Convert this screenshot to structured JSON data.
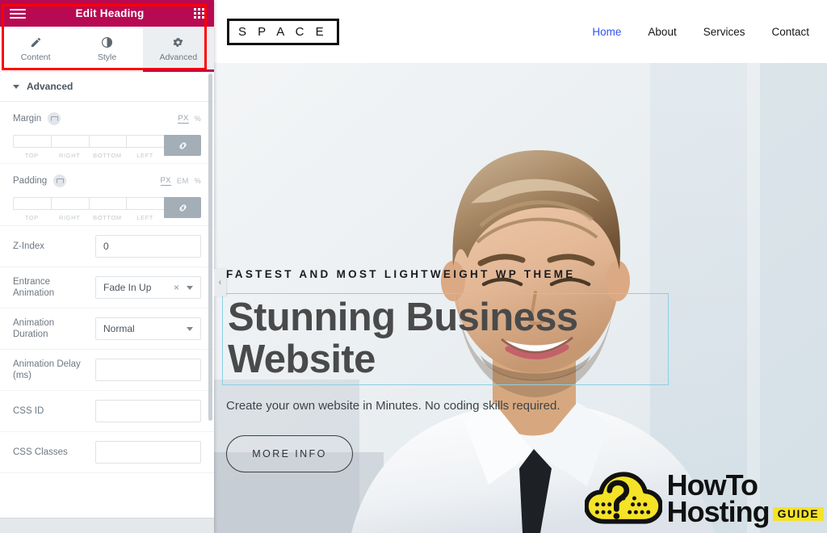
{
  "panel": {
    "header": {
      "title": "Edit Heading",
      "menu_icon": "hamburger-icon",
      "widgets_icon": "grid-icon"
    },
    "tabs": [
      {
        "label": "Content",
        "icon": "pencil-icon",
        "active": false
      },
      {
        "label": "Style",
        "icon": "contrast-icon",
        "active": false
      },
      {
        "label": "Advanced",
        "icon": "gear-icon",
        "active": true
      }
    ],
    "section": {
      "title": "Advanced"
    },
    "margin": {
      "label": "Margin",
      "units": [
        "PX",
        "%"
      ],
      "selected_unit": "PX",
      "values": [
        "",
        "",
        "",
        ""
      ],
      "captions": [
        "TOP",
        "RIGHT",
        "BOTTOM",
        "LEFT"
      ],
      "link_icon": "link-icon"
    },
    "padding": {
      "label": "Padding",
      "units": [
        "PX",
        "EM",
        "%"
      ],
      "selected_unit": "PX",
      "values": [
        "",
        "",
        "",
        ""
      ],
      "captions": [
        "TOP",
        "RIGHT",
        "BOTTOM",
        "LEFT"
      ],
      "link_icon": "link-icon"
    },
    "fields": {
      "z_index": {
        "label": "Z-Index",
        "value": "0"
      },
      "entrance_animation": {
        "label": "Entrance Animation",
        "value": "Fade In Up",
        "clear": "×"
      },
      "animation_duration": {
        "label": "Animation Duration",
        "value": "Normal"
      },
      "animation_delay": {
        "label": "Animation Delay (ms)",
        "value": ""
      },
      "css_id": {
        "label": "CSS ID",
        "value": ""
      },
      "css_classes": {
        "label": "CSS Classes",
        "value": ""
      }
    },
    "collapse_arrow": "‹",
    "highlight_color": "#ff0000",
    "accent_color": "#b80a53"
  },
  "preview": {
    "logo": "S P A C E",
    "nav": [
      {
        "label": "Home",
        "active": true
      },
      {
        "label": "About",
        "active": false
      },
      {
        "label": "Services",
        "active": false
      },
      {
        "label": "Contact",
        "active": false
      }
    ],
    "hero": {
      "eyebrow": "FASTEST AND MOST LIGHTWEIGHT WP THEME",
      "title": "Stunning Business Website",
      "subtitle": "Create your own website in Minutes. No coding skills required.",
      "button": "MORE INFO",
      "selection_color": "#8ccfe6",
      "nav_active_color": "#3253f0"
    }
  },
  "watermark": {
    "line1": "HowTo",
    "line2": "Hosting",
    "badge": "GUIDE",
    "icon": "cloud-question-icon",
    "color": "#f5e327"
  }
}
